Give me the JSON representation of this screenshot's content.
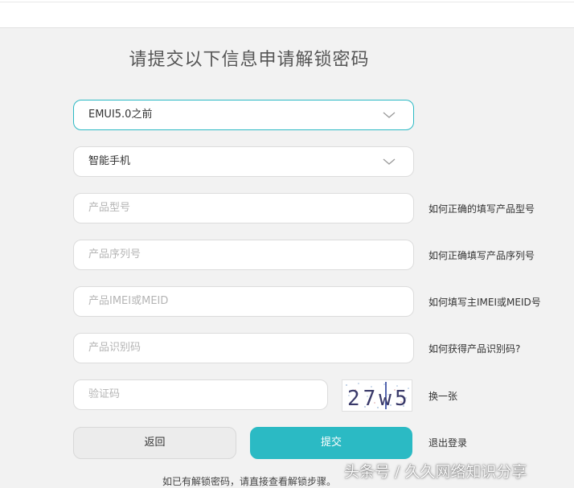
{
  "title": "请提交以下信息申请解锁密码",
  "version_select": {
    "value": "EMUI5.0之前"
  },
  "device_select": {
    "value": "智能手机"
  },
  "fields": {
    "model": {
      "placeholder": "产品型号",
      "help": "如何正确的填写产品型号"
    },
    "serial": {
      "placeholder": "产品序列号",
      "help": "如何正确填写产品序列号"
    },
    "imei": {
      "placeholder": "产品IMEI或MEID",
      "help": "如何填写主IMEI或MEID号"
    },
    "identifier": {
      "placeholder": "产品识别码",
      "help": "如何获得产品识别码?"
    },
    "captcha": {
      "placeholder": "验证码",
      "image_text": "27w5",
      "refresh": "换一张"
    }
  },
  "buttons": {
    "back": "返回",
    "submit": "提交",
    "logout": "退出登录"
  },
  "footer_note": "如已有解锁密码，请直接查看解锁步骤。",
  "watermark": "头条号 / 久久网络知识分享",
  "colors": {
    "accent": "#2bbac4",
    "placeholder": "#b5b5b5",
    "background": "#f2f2f2"
  }
}
